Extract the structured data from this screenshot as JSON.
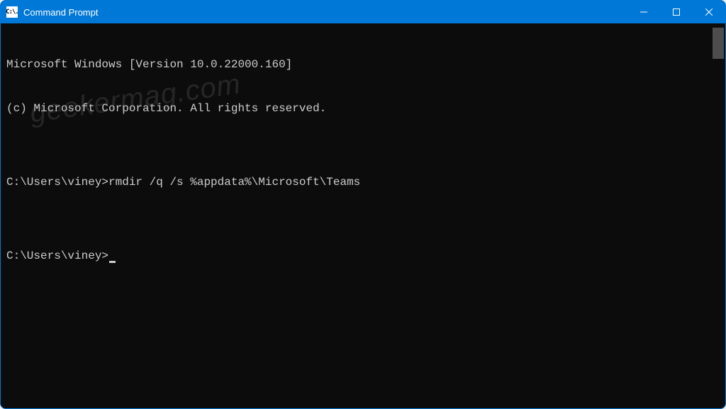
{
  "titlebar": {
    "icon_label": "C:\\.",
    "title": "Command Prompt"
  },
  "terminal": {
    "lines": [
      "Microsoft Windows [Version 10.0.22000.160]",
      "(c) Microsoft Corporation. All rights reserved.",
      "",
      "C:\\Users\\viney>rmdir /q /s %appdata%\\Microsoft\\Teams",
      ""
    ],
    "current_prompt": "C:\\Users\\viney>"
  },
  "watermark": "geekermag.com",
  "colors": {
    "accent": "#0078d7",
    "terminal_bg": "#0c0c0c",
    "terminal_fg": "#cccccc"
  }
}
